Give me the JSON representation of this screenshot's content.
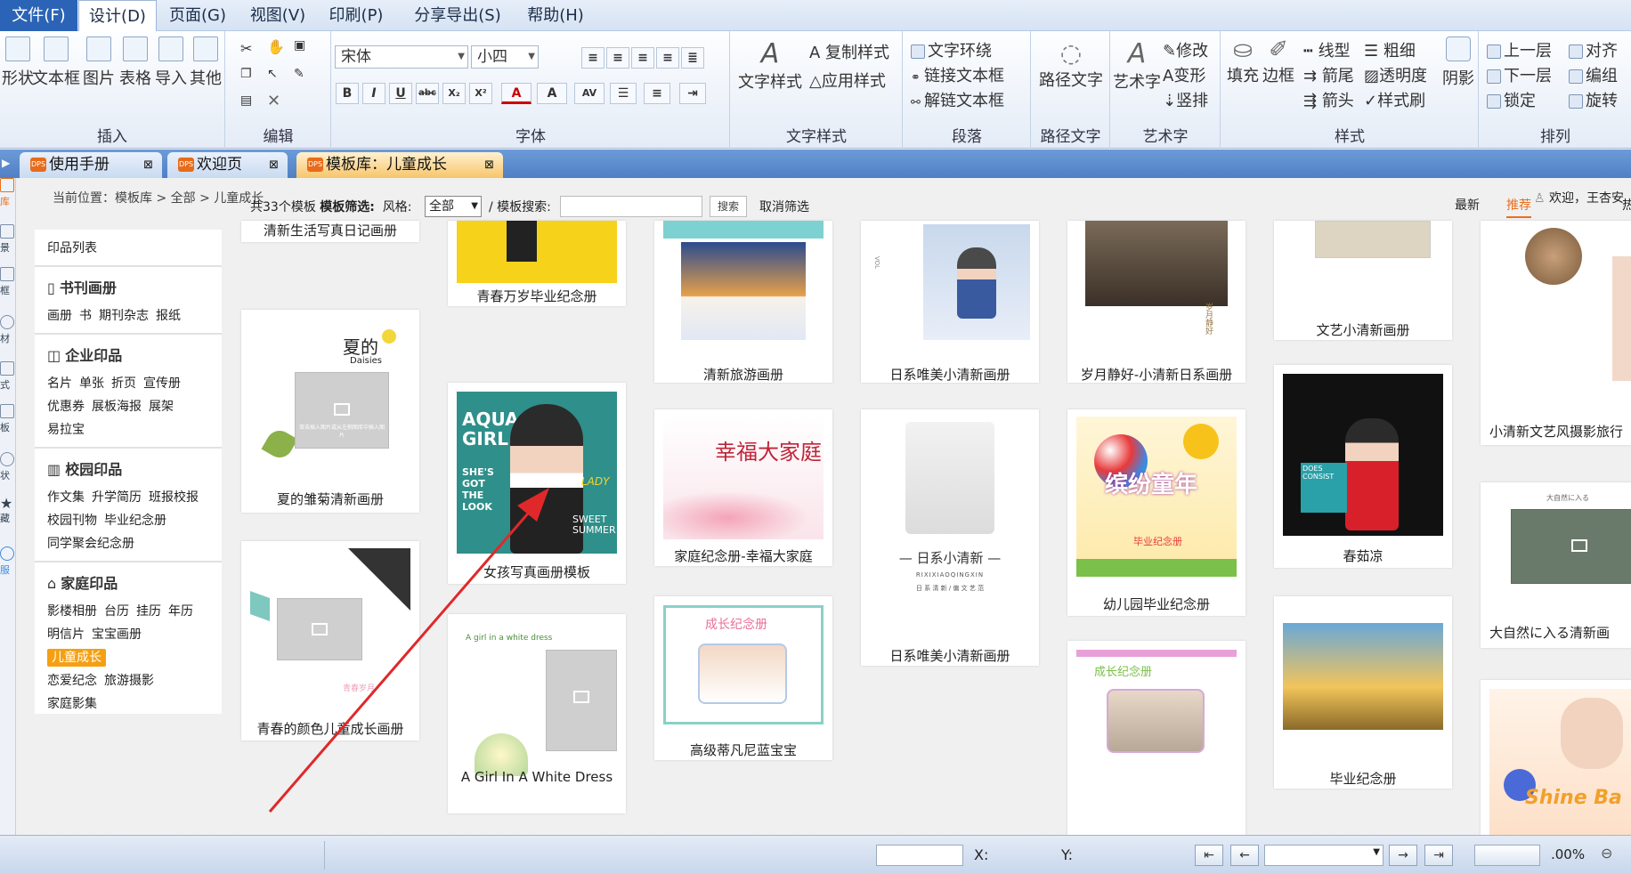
{
  "menubar": {
    "items": [
      "文件(F)",
      "设计(D)",
      "页面(G)",
      "视图(V)",
      "印刷(P)",
      "分享导出(S)",
      "帮助(H)"
    ]
  },
  "ribbon": {
    "insert": {
      "label": "插入",
      "buttons": [
        "形状",
        "文本框",
        "图片",
        "表格",
        "导入",
        "其他"
      ]
    },
    "edit": {
      "label": "编辑"
    },
    "font": {
      "label": "字体",
      "font_name": "宋体",
      "font_size": "小四",
      "buttons": [
        "B",
        "I",
        "U",
        "abc",
        "X₂",
        "X²",
        "A",
        "A",
        "AV"
      ]
    },
    "text_style": {
      "label": "文字样式",
      "big": "文字样式",
      "copy": "复制样式",
      "apply": "应用样式"
    },
    "paragraph": {
      "label": "段落",
      "wrap": "文字环绕",
      "link": "链接文本框",
      "unlink": "解链文本框"
    },
    "path_text": {
      "label": "路径文字",
      "big": "路径文字"
    },
    "art_text": {
      "label": "艺术字",
      "big": "艺术字",
      "modify": "修改",
      "transform": "变形",
      "vertical": "竖排"
    },
    "style": {
      "label": "样式",
      "fill": "填充",
      "border": "边框",
      "line_type": "线型",
      "thickness": "粗细",
      "arrow_end": "箭尾",
      "transparency": "透明度",
      "arrow_head": "箭头",
      "style_brush": "样式刷",
      "shadow": "阴影"
    },
    "arrange": {
      "label": "排列",
      "up": "上一层",
      "align": "对齐",
      "down": "下一层",
      "group": "编组",
      "lock": "锁定",
      "rotate": "旋转"
    }
  },
  "tabs": [
    {
      "label": "使用手册"
    },
    {
      "label": "欢迎页"
    },
    {
      "label": "模板库：儿童成长"
    }
  ],
  "leftstrip": [
    "库",
    "景",
    "框",
    "材",
    "式",
    "板",
    "状",
    "藏",
    "服"
  ],
  "breadcrumb": "当前位置：模板库 > 全部 > 儿童成长",
  "welcome": "欢迎，王杏安",
  "sidebar": {
    "title": "印品列表",
    "sections": [
      {
        "head": "书刊画册",
        "links": [
          "画册",
          "书",
          "期刊杂志",
          "报纸"
        ]
      },
      {
        "head": "企业印品",
        "links": [
          "名片",
          "单张",
          "折页",
          "宣传册",
          "优惠券",
          "展板海报",
          "展架",
          "易拉宝"
        ]
      },
      {
        "head": "校园印品",
        "links": [
          "作文集",
          "升学简历",
          "班报校报",
          "校园刊物",
          "毕业纪念册",
          "同学聚会纪念册"
        ]
      },
      {
        "head": "家庭印品",
        "links": [
          "影楼相册",
          "台历",
          "挂历",
          "年历",
          "明信片",
          "宝宝画册",
          "儿童成长",
          "恋爱纪念",
          "旅游摄影",
          "家庭影集"
        ]
      }
    ],
    "highlight": "儿童成长"
  },
  "filter": {
    "count": "共33个模板",
    "label": "模板筛选:",
    "style_label": "风格:",
    "style_value": "全部",
    "search_label": "/ 模板搜索:",
    "search_value": "",
    "search_button": "搜索",
    "clear": "取消筛选"
  },
  "sort": [
    "最新",
    "推荐",
    "热门"
  ],
  "cards": [
    "清新生活写真日记画册",
    "夏的雏菊清新画册",
    "青春的颜色儿童成长画册",
    "青春万岁毕业纪念册",
    "女孩写真画册模板",
    "A Girl In A White Dress",
    "清新旅游画册",
    "家庭纪念册-幸福大家庭",
    "高级蒂凡尼蓝宝宝",
    "日系唯美小清新画册",
    "日系唯美小清新画册",
    "岁月静好-小清新日系画册",
    "幼儿园毕业纪念册",
    "文艺小清新画册",
    "春茹凉",
    "毕业纪念册",
    "小清新文艺风摄影旅行",
    "大自然に入る清新画"
  ],
  "thumb_text": {
    "daisies_title": "夏的",
    "daisies_sub": "Daisies",
    "placeholder": "双击插入图片或从左侧图库中插入图片",
    "aqua": "AQUA GIRL",
    "shes": "SHE'S GOT THE LOOK",
    "lady": "LADY",
    "sweet": "SWEET SUMMER",
    "white_dress_title": "A girl in a white dress",
    "family_title": "幸福大家庭",
    "growth_title": "成长纪念册",
    "jp_title": "— 日系小清新 —",
    "jp_sub": "RIXIXIAOQINGXIN",
    "jp_sub2": "日 系 清 新 / 偏 文 艺 范",
    "colorful": "缤纷童年",
    "grad": "毕业纪念册",
    "years": "岁月静好",
    "nature": "大自然に入る",
    "shine": "Shine Ba",
    "vol": "VOL",
    "youth": "青春岁月"
  },
  "statusbar": {
    "x_label": "X:",
    "y_label": "Y:",
    "zoom": ".00%"
  }
}
